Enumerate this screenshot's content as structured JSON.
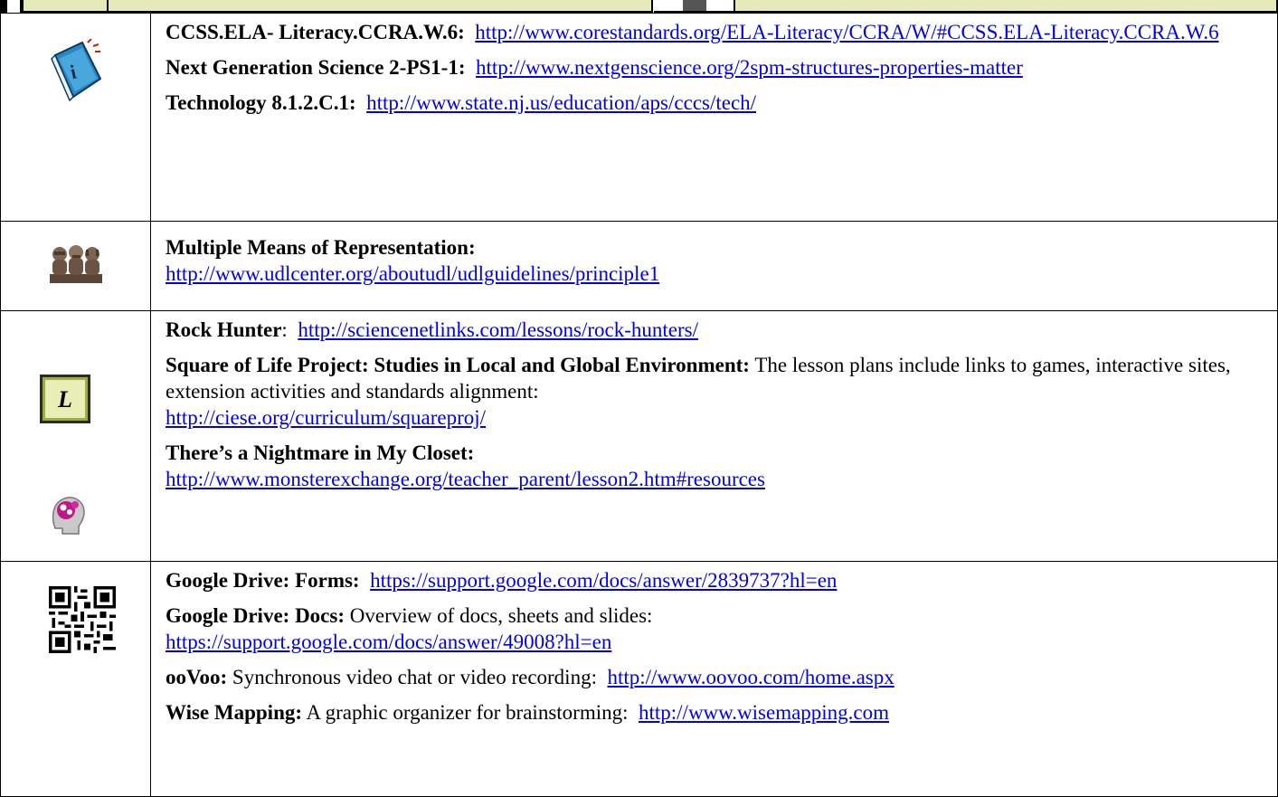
{
  "rows": [
    {
      "icon": "info-book-icon",
      "entries": [
        {
          "label": "CCSS.ELA- Literacy.CCRA.W.6:",
          "desc": "",
          "url": "http://www.corestandards.org/ELA-Literacy/CCRA/W/#CCSS.ELA-Literacy.CCRA.W.6"
        },
        {
          "label": "Next Generation Science 2-PS1-1:",
          "desc": "",
          "url": "http://www.nextgenscience.org/2spm-structures-properties-matter"
        },
        {
          "label": "Technology 8.1.2.C.1:",
          "desc": "",
          "url": "http://www.state.nj.us/education/aps/cccs/tech/"
        }
      ]
    },
    {
      "icon": "three-monkeys-icon",
      "entries": [
        {
          "label": "Multiple Means of Representation:",
          "desc": "",
          "url": "http://www.udlcenter.org/aboutudl/udlguidelines/principle1"
        }
      ]
    },
    {
      "icon": "lesson-L-icon",
      "icon_text": "L",
      "entries": [
        {
          "label": "Rock Hunter",
          "desc": ":",
          "url": "http://sciencenetlinks.com/lessons/rock-hunters/"
        },
        {
          "label": "Square of Life Project:  Studies in Local and Global Environment:",
          "desc": "The lesson plans include links to games, interactive sites, extension activities and standards alignment:",
          "url": "http://ciese.org/curriculum/squareproj/"
        },
        {
          "label": "There’s a Nightmare in My Closet:",
          "desc": "",
          "url": "http://www.monsterexchange.org/teacher_parent/lesson2.htm#resources"
        }
      ]
    },
    {
      "icon": "qr-code-icon",
      "entries": [
        {
          "label": "Google Drive: Forms:",
          "desc": "",
          "url": "https://support.google.com/docs/answer/2839737?hl=en"
        },
        {
          "label": "Google Drive: Docs:",
          "desc": "Overview of docs, sheets and slides:",
          "url": "https://support.google.com/docs/answer/49008?hl=en"
        },
        {
          "label": "ooVoo:",
          "desc": "Synchronous video chat or video recording:",
          "url": "http://www.oovoo.com/home.aspx"
        },
        {
          "label": "Wise Mapping:",
          "desc": "A graphic organizer for brainstorming:",
          "url": "http://www.wisemapping.com"
        }
      ]
    }
  ],
  "colors": {
    "link": "#0000ee",
    "header_fill": "#e6e9b8",
    "border": "#000000"
  }
}
